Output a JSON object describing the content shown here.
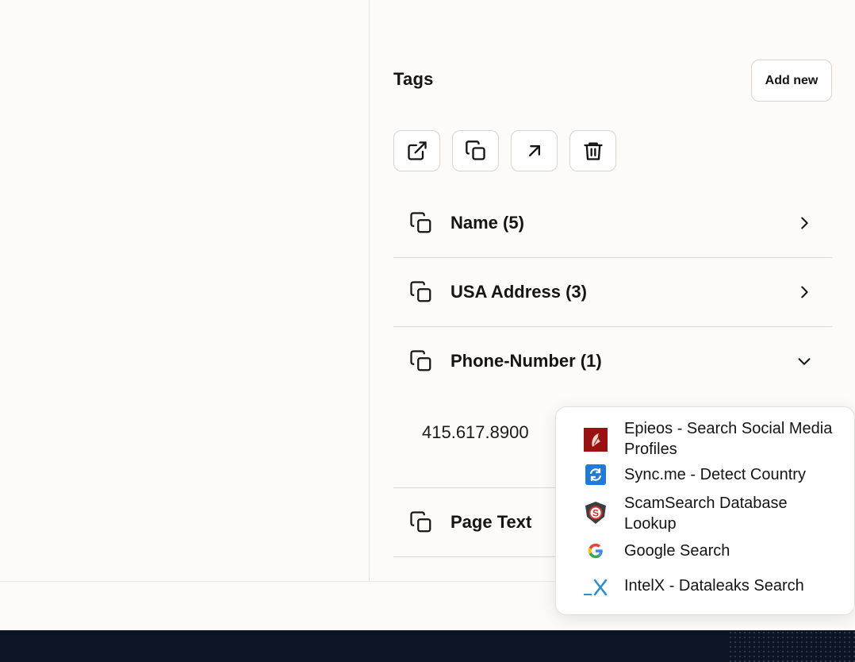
{
  "tags_panel": {
    "title": "Tags",
    "add_new_label": "Add new",
    "toolbar": [
      "open-external",
      "copy",
      "arrow-up-right",
      "delete"
    ],
    "sections": [
      {
        "label": "Name (5)",
        "expanded": false
      },
      {
        "label": "USA Address (3)",
        "expanded": false
      },
      {
        "label": "Phone-Number (1)",
        "expanded": true,
        "values": [
          "415.617.8900"
        ]
      },
      {
        "label": "Page Text",
        "expanded": false
      }
    ]
  },
  "context_menu": {
    "items": [
      {
        "label": "Epieos - Search Social Media Profiles",
        "icon": "epieos-icon"
      },
      {
        "label": "Sync.me - Detect Country",
        "icon": "syncme-icon"
      },
      {
        "label": "ScamSearch Database Lookup",
        "icon": "scamsearch-icon"
      },
      {
        "label": "Google Search",
        "icon": "google-icon"
      },
      {
        "label": "IntelX - Dataleaks Search",
        "icon": "intelx-icon"
      }
    ]
  },
  "colors": {
    "background": "#fcfbf9",
    "text": "#141414",
    "border": "#d7d4cf",
    "dark_footer": "#0d1424",
    "intelx_blue": "#2b8fd6"
  }
}
